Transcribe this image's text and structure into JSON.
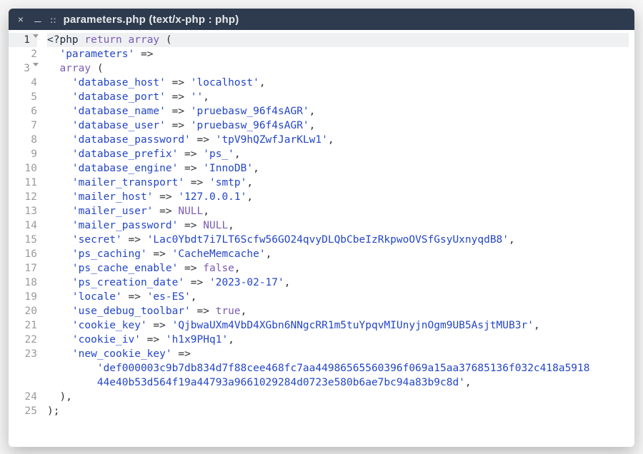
{
  "window": {
    "title_prefix": "::",
    "title": "parameters.php (text/x-php : php)"
  },
  "code": {
    "highlighted_line": 1,
    "lines": [
      {
        "n": 1,
        "foldable": true,
        "tokens": [
          [
            "tag",
            "<?php "
          ],
          [
            "kw",
            "return "
          ],
          [
            "kw",
            "array"
          ],
          [
            "pun",
            " ("
          ]
        ]
      },
      {
        "n": 2,
        "foldable": false,
        "tokens": [
          [
            "pun",
            "  "
          ],
          [
            "str",
            "'parameters'"
          ],
          [
            "pun",
            " =>"
          ]
        ]
      },
      {
        "n": 3,
        "foldable": true,
        "tokens": [
          [
            "pun",
            "  "
          ],
          [
            "kw",
            "array"
          ],
          [
            "pun",
            " ("
          ]
        ]
      },
      {
        "n": 4,
        "foldable": false,
        "tokens": [
          [
            "pun",
            "    "
          ],
          [
            "key",
            "'database_host'"
          ],
          [
            "arrow",
            " => "
          ],
          [
            "str",
            "'localhost'"
          ],
          [
            "pun",
            ","
          ]
        ]
      },
      {
        "n": 5,
        "foldable": false,
        "tokens": [
          [
            "pun",
            "    "
          ],
          [
            "key",
            "'database_port'"
          ],
          [
            "arrow",
            " => "
          ],
          [
            "str",
            "''"
          ],
          [
            "pun",
            ","
          ]
        ]
      },
      {
        "n": 6,
        "foldable": false,
        "tokens": [
          [
            "pun",
            "    "
          ],
          [
            "key",
            "'database_name'"
          ],
          [
            "arrow",
            " => "
          ],
          [
            "str",
            "'pruebasw_96f4sAGR'"
          ],
          [
            "pun",
            ","
          ]
        ]
      },
      {
        "n": 7,
        "foldable": false,
        "tokens": [
          [
            "pun",
            "    "
          ],
          [
            "key",
            "'database_user'"
          ],
          [
            "arrow",
            " => "
          ],
          [
            "str",
            "'pruebasw_96f4sAGR'"
          ],
          [
            "pun",
            ","
          ]
        ]
      },
      {
        "n": 8,
        "foldable": false,
        "tokens": [
          [
            "pun",
            "    "
          ],
          [
            "key",
            "'database_password'"
          ],
          [
            "arrow",
            " => "
          ],
          [
            "str",
            "'tpV9hQZwfJarKLw1'"
          ],
          [
            "pun",
            ","
          ]
        ]
      },
      {
        "n": 9,
        "foldable": false,
        "tokens": [
          [
            "pun",
            "    "
          ],
          [
            "key",
            "'database_prefix'"
          ],
          [
            "arrow",
            " => "
          ],
          [
            "str",
            "'ps_'"
          ],
          [
            "pun",
            ","
          ]
        ]
      },
      {
        "n": 10,
        "foldable": false,
        "tokens": [
          [
            "pun",
            "    "
          ],
          [
            "key",
            "'database_engine'"
          ],
          [
            "arrow",
            " => "
          ],
          [
            "str",
            "'InnoDB'"
          ],
          [
            "pun",
            ","
          ]
        ]
      },
      {
        "n": 11,
        "foldable": false,
        "tokens": [
          [
            "pun",
            "    "
          ],
          [
            "key",
            "'mailer_transport'"
          ],
          [
            "arrow",
            " => "
          ],
          [
            "str",
            "'smtp'"
          ],
          [
            "pun",
            ","
          ]
        ]
      },
      {
        "n": 12,
        "foldable": false,
        "tokens": [
          [
            "pun",
            "    "
          ],
          [
            "key",
            "'mailer_host'"
          ],
          [
            "arrow",
            " => "
          ],
          [
            "str",
            "'127.0.0.1'"
          ],
          [
            "pun",
            ","
          ]
        ]
      },
      {
        "n": 13,
        "foldable": false,
        "tokens": [
          [
            "pun",
            "    "
          ],
          [
            "key",
            "'mailer_user'"
          ],
          [
            "arrow",
            " => "
          ],
          [
            "kw",
            "NULL"
          ],
          [
            "pun",
            ","
          ]
        ]
      },
      {
        "n": 14,
        "foldable": false,
        "tokens": [
          [
            "pun",
            "    "
          ],
          [
            "key",
            "'mailer_password'"
          ],
          [
            "arrow",
            " => "
          ],
          [
            "kw",
            "NULL"
          ],
          [
            "pun",
            ","
          ]
        ]
      },
      {
        "n": 15,
        "foldable": false,
        "tokens": [
          [
            "pun",
            "    "
          ],
          [
            "key",
            "'secret'"
          ],
          [
            "arrow",
            " => "
          ],
          [
            "str",
            "'Lac0Ybdt7i7LT6Scfw56GO24qvyDLQbCbeIzRkpwoOVSfGsyUxnyqdB8'"
          ],
          [
            "pun",
            ","
          ]
        ]
      },
      {
        "n": 16,
        "foldable": false,
        "tokens": [
          [
            "pun",
            "    "
          ],
          [
            "key",
            "'ps_caching'"
          ],
          [
            "arrow",
            " => "
          ],
          [
            "str",
            "'CacheMemcache'"
          ],
          [
            "pun",
            ","
          ]
        ]
      },
      {
        "n": 17,
        "foldable": false,
        "tokens": [
          [
            "pun",
            "    "
          ],
          [
            "key",
            "'ps_cache_enable'"
          ],
          [
            "arrow",
            " => "
          ],
          [
            "kw",
            "false"
          ],
          [
            "pun",
            ","
          ]
        ]
      },
      {
        "n": 18,
        "foldable": false,
        "tokens": [
          [
            "pun",
            "    "
          ],
          [
            "key",
            "'ps_creation_date'"
          ],
          [
            "arrow",
            " => "
          ],
          [
            "str",
            "'2023-02-17'"
          ],
          [
            "pun",
            ","
          ]
        ]
      },
      {
        "n": 19,
        "foldable": false,
        "tokens": [
          [
            "pun",
            "    "
          ],
          [
            "key",
            "'locale'"
          ],
          [
            "arrow",
            " => "
          ],
          [
            "str",
            "'es-ES'"
          ],
          [
            "pun",
            ","
          ]
        ]
      },
      {
        "n": 20,
        "foldable": false,
        "tokens": [
          [
            "pun",
            "    "
          ],
          [
            "key",
            "'use_debug_toolbar'"
          ],
          [
            "arrow",
            " => "
          ],
          [
            "kw",
            "true"
          ],
          [
            "pun",
            ","
          ]
        ]
      },
      {
        "n": 21,
        "foldable": false,
        "tokens": [
          [
            "pun",
            "    "
          ],
          [
            "key",
            "'cookie_key'"
          ],
          [
            "arrow",
            " => "
          ],
          [
            "str",
            "'QjbwaUXm4VbD4XGbn6NNgcRR1m5tuYpqvMIUnyjnOgm9UB5AsjtMUB3r'"
          ],
          [
            "pun",
            ","
          ]
        ]
      },
      {
        "n": 22,
        "foldable": false,
        "tokens": [
          [
            "pun",
            "    "
          ],
          [
            "key",
            "'cookie_iv'"
          ],
          [
            "arrow",
            " => "
          ],
          [
            "str",
            "'h1x9PHq1'"
          ],
          [
            "pun",
            ","
          ]
        ]
      },
      {
        "n": 23,
        "foldable": false,
        "tokens": [
          [
            "pun",
            "    "
          ],
          [
            "key",
            "'new_cookie_key'"
          ],
          [
            "arrow",
            " => "
          ]
        ]
      },
      {
        "n": 0,
        "foldable": false,
        "cont": true,
        "tokens": [
          [
            "pun",
            "        "
          ],
          [
            "str",
            "'def000003c9b7db834d7f88cee468fc7aa44986565560396f069a15aa37685136f032c418a5918"
          ]
        ]
      },
      {
        "n": 0,
        "foldable": false,
        "cont": true,
        "tokens": [
          [
            "pun",
            "        "
          ],
          [
            "str",
            "44e40b53d564f19a44793a9661029284d0723e580b6ae7bc94a83b9c8d'"
          ],
          [
            "pun",
            ","
          ]
        ]
      },
      {
        "n": 24,
        "foldable": false,
        "tokens": [
          [
            "pun",
            "  ),"
          ]
        ]
      },
      {
        "n": 25,
        "foldable": false,
        "tokens": [
          [
            "pun",
            ");"
          ]
        ]
      }
    ]
  }
}
